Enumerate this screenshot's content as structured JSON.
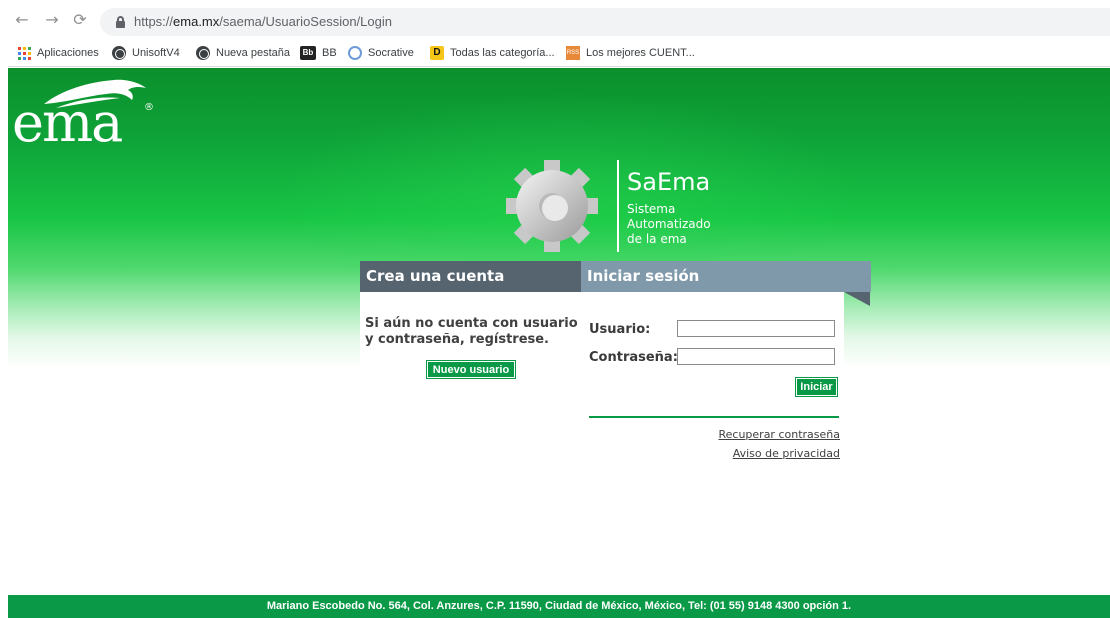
{
  "browser": {
    "url_scheme": "https://",
    "url_host": "ema.mx",
    "url_path": "/saema/UsuarioSession/Login",
    "nav_icons": [
      "back-arrow-icon",
      "forward-arrow-icon",
      "reload-icon",
      "lock-icon"
    ],
    "bookmarks": [
      {
        "label": "Aplicaciones",
        "icon": "apps-grid-icon"
      },
      {
        "label": "UnisoftV4",
        "icon": "globe-icon"
      },
      {
        "label": "Nueva pestaña",
        "icon": "globe-icon"
      },
      {
        "label": "BB",
        "icon": "blackboard-icon",
        "badge": "Bb"
      },
      {
        "label": "Socrative",
        "icon": "socrative-icon"
      },
      {
        "label": "Todas las categoría...",
        "icon": "d-icon",
        "badge": "D"
      },
      {
        "label": "Los mejores CUENT...",
        "icon": "bookmark-site-icon",
        "badge": "RSS"
      }
    ]
  },
  "brand": {
    "logo_text": "ema",
    "logo_registered": "®",
    "app_name": "SaEma",
    "app_tagline": [
      "Sistema",
      "Automatizado",
      "de la ema"
    ]
  },
  "create_account": {
    "tab_title": "Crea una cuenta",
    "message": "Si aún no cuenta con usuario y contraseña, regístrese.",
    "button": "Nuevo usuario"
  },
  "login": {
    "tab_title": "Iniciar sesión",
    "username_label": "Usuario:",
    "username_value": "",
    "password_label": "Contraseña:",
    "password_value": "",
    "submit_button": "Iniciar",
    "recover_link": "Recuperar contraseña",
    "privacy_link": "Aviso de privacidad"
  },
  "footer": {
    "address": "Mariano Escobedo No. 564, Col. Anzures, C.P. 11590, Ciudad de México, México, Tel: (01 55) 9148 4300 opción 1."
  },
  "colors": {
    "brand_green": "#0a9a47",
    "header_green": "#0fa63a",
    "tab_dark": "#566470",
    "tab_light": "#7f99aa"
  }
}
